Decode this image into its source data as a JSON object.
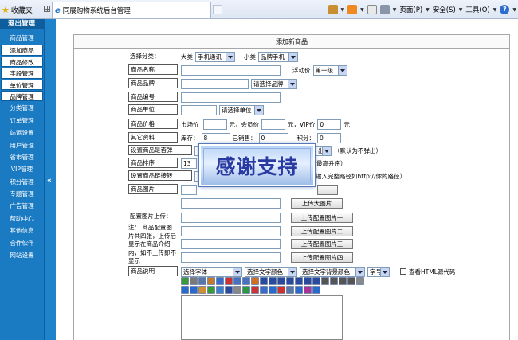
{
  "browser": {
    "favorites": "收藏夹",
    "tab_title": "同展购物系统后台管理",
    "menu": {
      "page": "页面(P)",
      "safety": "安全(S)",
      "tools": "工具(O)"
    }
  },
  "sidebar": {
    "title": "退出管理",
    "items": [
      {
        "label": "商品管理",
        "boxed": false
      },
      {
        "label": "添加商品",
        "boxed": true
      },
      {
        "label": "商品修改",
        "boxed": true
      },
      {
        "label": "字段管理",
        "boxed": true
      },
      {
        "label": "单位管理",
        "boxed": true
      },
      {
        "label": "品牌管理",
        "boxed": true
      },
      {
        "label": "分类管理",
        "boxed": false
      },
      {
        "label": "订单管理",
        "boxed": false
      },
      {
        "label": "站运设置",
        "boxed": false
      },
      {
        "label": "用户管理",
        "boxed": false
      },
      {
        "label": "省市管理",
        "boxed": false
      },
      {
        "label": "VIP管理",
        "boxed": false
      },
      {
        "label": "积分管理",
        "boxed": false
      },
      {
        "label": "专题管理",
        "boxed": false
      },
      {
        "label": "广告管理",
        "boxed": false
      },
      {
        "label": "帮助中心",
        "boxed": false
      },
      {
        "label": "其他信息",
        "boxed": false
      },
      {
        "label": "合作伙伴",
        "boxed": false
      },
      {
        "label": "网站设置",
        "boxed": false
      }
    ],
    "collapse": "«"
  },
  "form": {
    "title": "添加新商品",
    "category": {
      "label": "选择分类：",
      "big_label": "大类",
      "big_value": "手机通讯",
      "small_label": "小类",
      "small_value": "品牌手机"
    },
    "name": {
      "label": "商品名称",
      "float_label": "浮动价",
      "float_value": "第一级"
    },
    "brand": {
      "label": "商品品牌",
      "select": "请选择品牌"
    },
    "code": {
      "label": "商品编号"
    },
    "unit": {
      "label": "商品单位",
      "select": "请选择单位"
    },
    "price": {
      "label": "商品价格",
      "market": "市场价",
      "yuan1": "元，会员价",
      "yuan2": "元，VIP价",
      "vip_value": "0",
      "yuan3": "元"
    },
    "other": {
      "label": "其它资料",
      "stock": "库存：",
      "stock_value": "8",
      "sold": "已销售：",
      "sold_value": "0",
      "points": "积分：",
      "points_value": "0"
    },
    "popup": {
      "label": "设置商品是否弹",
      "select": "出",
      "note": "（默认为不弹出）"
    },
    "sort": {
      "label": "商品排序",
      "value": "13",
      "note": "最高升序）"
    },
    "link": {
      "label": "设置商品链接转",
      "note": "输入完整路径如http://你的路径）"
    },
    "image": {
      "label": "商品图片",
      "btn_big": "上传大图片"
    },
    "config": {
      "label": "配置图片上传：",
      "note": "注： 商品配置图片共四张，上传后显示在商品介绍内，如不上传即不显示",
      "btn1": "上传配置图片一",
      "btn2": "上传配置图片二",
      "btn3": "上传配置图片三",
      "btn4": "上传配置图片四"
    },
    "desc": {
      "label": "商品说明",
      "font": "选择字体",
      "color": "选择文字颜色",
      "bgcolor": "选择文字背景颜色",
      "size": "字号",
      "html": "查看HTML源代码"
    }
  },
  "overlay": {
    "text": "感谢支持"
  }
}
